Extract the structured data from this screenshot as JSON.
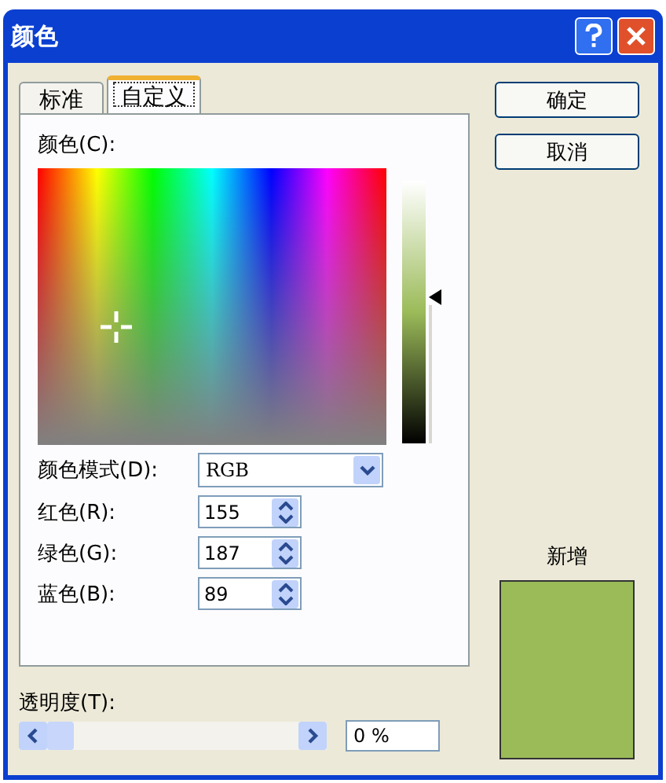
{
  "window": {
    "title": "颜色"
  },
  "tabs": [
    {
      "label": "标准",
      "selected": false
    },
    {
      "label": "自定义",
      "selected": true
    }
  ],
  "color_label": "颜色(C):",
  "luminance": {
    "level": 0.56
  },
  "mode": {
    "label": "颜色模式(D):",
    "value": "RGB"
  },
  "channels": [
    {
      "label": "红色(R):",
      "value": "155"
    },
    {
      "label": "绿色(G):",
      "value": "187"
    },
    {
      "label": "蓝色(B):",
      "value": "89"
    }
  ],
  "buttons": [
    "确定",
    "取消"
  ],
  "new_label": "新增",
  "transparency": {
    "label": "透明度(T):",
    "level": 0,
    "value": "0 %"
  }
}
